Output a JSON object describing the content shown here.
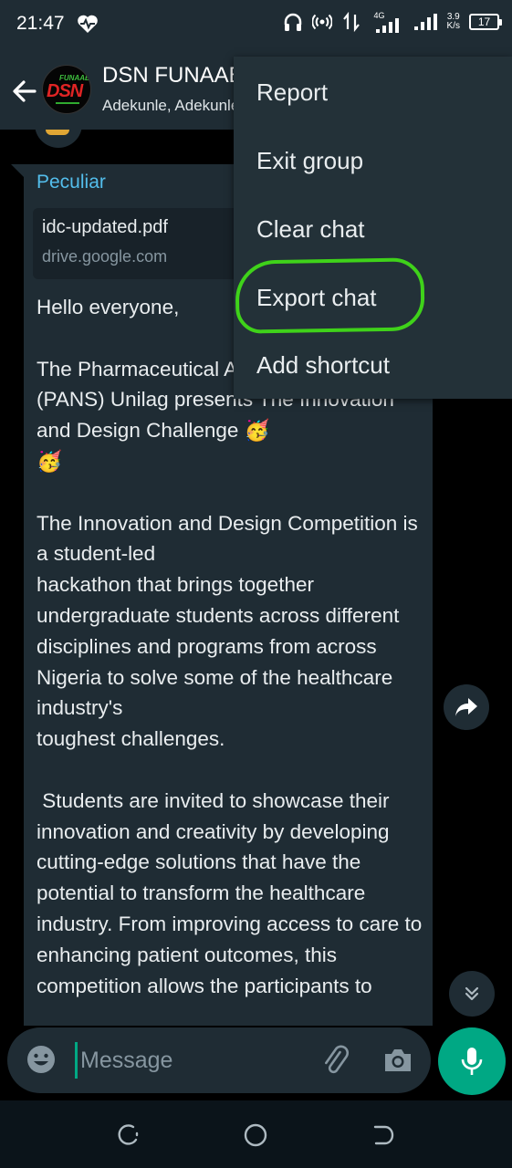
{
  "status_bar": {
    "time": "21:47",
    "network_type": "4G",
    "speed_value": "3.9",
    "speed_unit": "K/s",
    "battery": "17",
    "icons": [
      "heart-monitor-icon",
      "headphones-icon",
      "hotspot-icon",
      "data-transfer-icon",
      "signal-icon",
      "signal-icon",
      "battery-icon"
    ]
  },
  "header": {
    "group_name": "DSN FUNAAB",
    "members": "Adekunle, Adekunle",
    "avatar": {
      "top_text": "FUNAAB",
      "main_text": "DSN"
    }
  },
  "message": {
    "sender": "Peculiar",
    "sender_color": "#53bdeb",
    "link_title": "idc-updated.pdf",
    "link_domain": "drive.google.com",
    "body": "Hello everyone,\n\nThe Pharmaceutical Association of Nigeria (PANS) Unilag presents The Innovation and Design Challenge 🥳\n🥳\n\nThe Innovation and Design Competition is a student-led\nhackathon that brings together undergraduate students across different disciplines and programs from across Nigeria to solve some of the healthcare industry's\ntoughest challenges.\n\n Students are invited to showcase their innovation and creativity by developing cutting-edge solutions that have the potential to transform the healthcare industry. From improving access to care to enhancing patient outcomes, this competition allows the participants to"
  },
  "menu": {
    "items": [
      "Report",
      "Exit group",
      "Clear chat",
      "Export chat",
      "Add shortcut"
    ],
    "highlighted_item": "Export chat",
    "highlight_color": "#3fd21a"
  },
  "input": {
    "placeholder": "Message",
    "value": ""
  },
  "colors": {
    "accent": "#00a884",
    "surface": "#1f2c34",
    "background": "#000000"
  }
}
